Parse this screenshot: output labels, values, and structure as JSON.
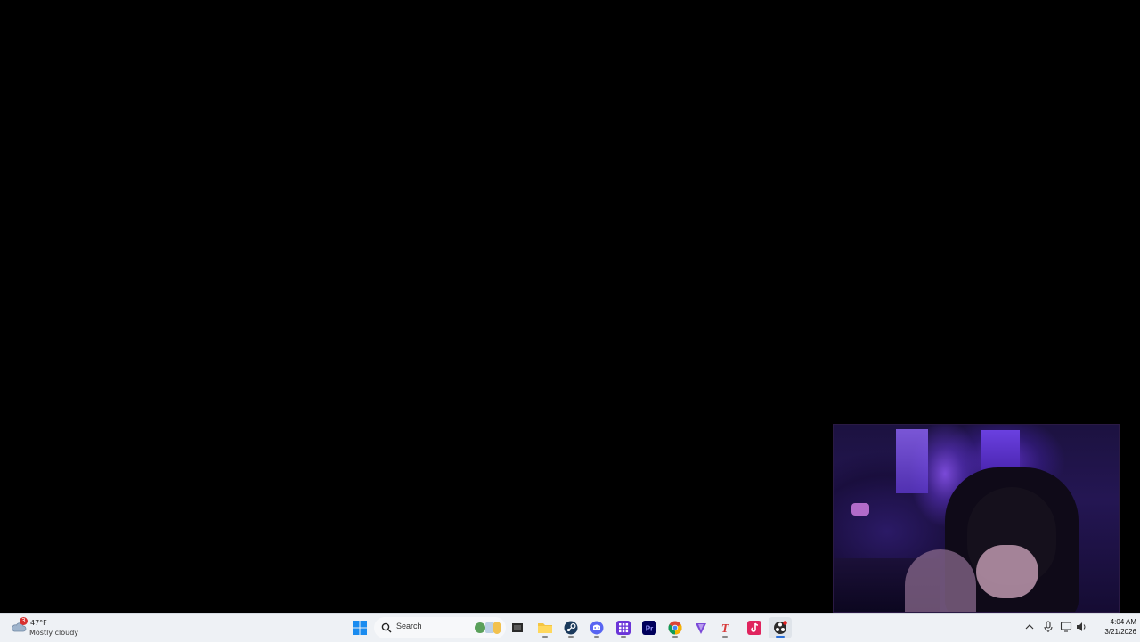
{
  "desktop": {
    "background_color": "#000000"
  },
  "webcam": {
    "alt": "Streamer webcam"
  },
  "taskbar": {
    "weather": {
      "temperature": "47°F",
      "condition": "Mostly cloudy",
      "badge": "3"
    },
    "search": {
      "placeholder": "Search"
    },
    "apps": [
      {
        "name": "start-button",
        "icon": "windows-logo-icon"
      },
      {
        "name": "task-view",
        "icon": "task-view-icon"
      },
      {
        "name": "file-explorer",
        "icon": "folder-icon"
      },
      {
        "name": "steam",
        "icon": "steam-icon"
      },
      {
        "name": "discord",
        "icon": "discord-icon"
      },
      {
        "name": "app-grid",
        "icon": "grid-app-icon"
      },
      {
        "name": "premiere-pro",
        "icon": "premiere-pro-icon",
        "label": "Pr"
      },
      {
        "name": "google-chrome",
        "icon": "chrome-icon"
      },
      {
        "name": "vpn",
        "icon": "shield-v-icon"
      },
      {
        "name": "t-app",
        "icon": "t-letter-icon",
        "label": "T"
      },
      {
        "name": "tiktok",
        "icon": "tiktok-icon"
      },
      {
        "name": "obs-studio",
        "icon": "obs-icon"
      }
    ],
    "tray": {
      "icons": [
        "chevron-up-icon",
        "microphone-icon",
        "network-icon",
        "volume-icon"
      ],
      "time": "4:04 AM",
      "date": "3/21/2026"
    }
  }
}
